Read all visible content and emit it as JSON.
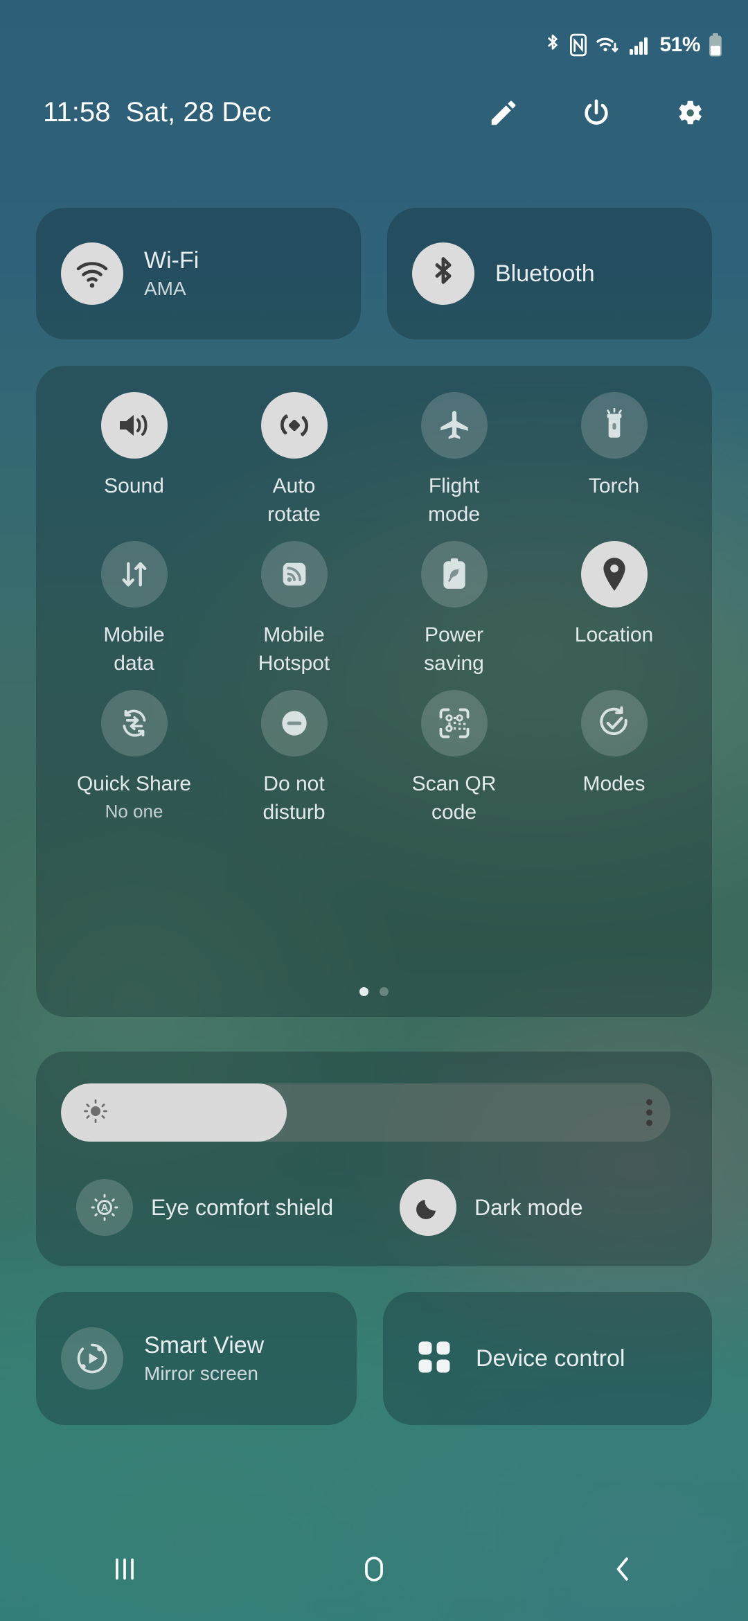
{
  "statusbar": {
    "icons": [
      "bluetooth-icon",
      "nfc-icon",
      "wifi-icon",
      "signal-icon"
    ],
    "battery_percent": "51%"
  },
  "header": {
    "time": "11:58",
    "date": "Sat, 28 Dec",
    "actions": [
      {
        "name": "edit-button",
        "icon": "pencil-icon"
      },
      {
        "name": "power-button",
        "icon": "power-icon"
      },
      {
        "name": "settings-button",
        "icon": "gear-icon"
      }
    ]
  },
  "top_tiles": [
    {
      "label": "Wi-Fi",
      "sublabel": "AMA",
      "icon": "wifi-icon",
      "active": true
    },
    {
      "label": "Bluetooth",
      "sublabel": "",
      "icon": "bluetooth-icon",
      "active": true
    }
  ],
  "toggles": [
    {
      "label": "Sound",
      "sublabel": "",
      "icon": "volume-icon",
      "active": true
    },
    {
      "label": "Auto\nrotate",
      "sublabel": "",
      "icon": "auto-rotate-icon",
      "active": true
    },
    {
      "label": "Flight\nmode",
      "sublabel": "",
      "icon": "airplane-icon",
      "active": false
    },
    {
      "label": "Torch",
      "sublabel": "",
      "icon": "flashlight-icon",
      "active": false
    },
    {
      "label": "Mobile\ndata",
      "sublabel": "",
      "icon": "mobile-data-icon",
      "active": false
    },
    {
      "label": "Mobile\nHotspot",
      "sublabel": "",
      "icon": "hotspot-icon",
      "active": false
    },
    {
      "label": "Power\nsaving",
      "sublabel": "",
      "icon": "power-saving-icon",
      "active": false
    },
    {
      "label": "Location",
      "sublabel": "",
      "icon": "location-pin-icon",
      "active": true
    },
    {
      "label": "Quick Share",
      "sublabel": "No one",
      "icon": "quick-share-icon",
      "active": false
    },
    {
      "label": "Do not\ndisturb",
      "sublabel": "",
      "icon": "do-not-disturb-icon",
      "active": false
    },
    {
      "label": "Scan QR\ncode",
      "sublabel": "",
      "icon": "qr-scan-icon",
      "active": false
    },
    {
      "label": "Modes",
      "sublabel": "",
      "icon": "modes-check-icon",
      "active": false
    }
  ],
  "page_indicator": {
    "count": 2,
    "current": 1
  },
  "brightness": {
    "icon": "brightness-sun-icon",
    "fill_percent": 37,
    "menu_icon": "more-options-icon"
  },
  "display_modes": [
    {
      "label": "Eye comfort shield",
      "icon": "eye-comfort-icon",
      "active": false
    },
    {
      "label": "Dark mode",
      "icon": "moon-icon",
      "active": true
    }
  ],
  "bottom_tiles": [
    {
      "label": "Smart View",
      "sublabel": "Mirror screen",
      "icon": "smart-view-icon",
      "active": false
    },
    {
      "label": "Device control",
      "sublabel": "",
      "icon": "device-control-icon",
      "active": false
    }
  ],
  "navbar": [
    {
      "name": "recents-button",
      "icon": "recents-icon"
    },
    {
      "name": "home-button",
      "icon": "home-icon"
    },
    {
      "name": "back-button",
      "icon": "back-icon"
    }
  ]
}
